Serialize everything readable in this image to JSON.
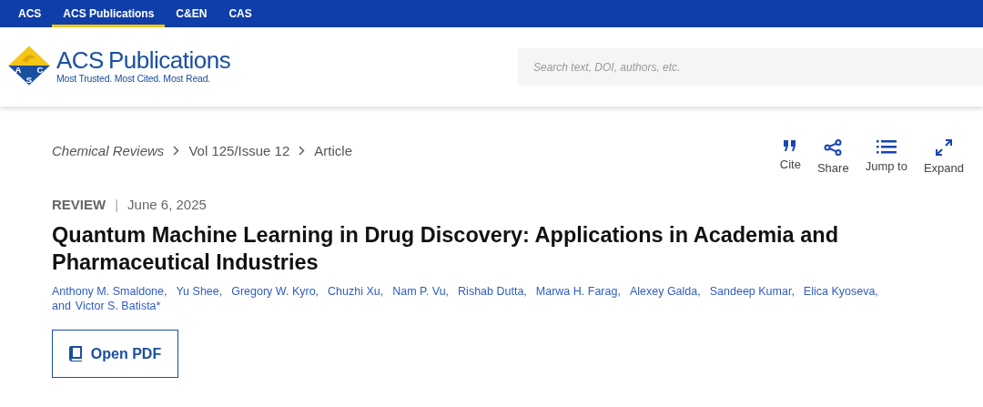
{
  "top_nav": [
    {
      "label": "ACS",
      "selected": false
    },
    {
      "label": "ACS Publications",
      "selected": true
    },
    {
      "label": "C&EN",
      "selected": false
    },
    {
      "label": "CAS",
      "selected": false
    }
  ],
  "logo": {
    "emblem_letters": [
      "A",
      "C",
      "S"
    ],
    "wordmark_bold": "ACS",
    "wordmark": "Publications",
    "tagline": "Most Trusted. Most Cited. Most Read."
  },
  "search": {
    "placeholder": "Search text, DOI, authors, etc."
  },
  "breadcrumb": [
    {
      "label": "Chemical Reviews",
      "kind": "journal"
    },
    {
      "label": "Vol 125/Issue 12",
      "kind": "issue"
    },
    {
      "label": "Article",
      "kind": "current"
    }
  ],
  "actions": [
    {
      "label": "Cite",
      "kind": "cite"
    },
    {
      "label": "Share",
      "kind": "share"
    },
    {
      "label": "Jump to",
      "kind": "jump"
    },
    {
      "label": "Expand",
      "kind": "expand"
    }
  ],
  "article": {
    "type": "REVIEW",
    "separator": "|",
    "date": "June 6, 2025",
    "title": "Quantum Machine Learning in Drug Discovery: Applications in Academia and Pharmaceutical Industries",
    "authors": [
      {
        "name": "Anthony M. Smaldone,"
      },
      {
        "name": "Yu Shee,"
      },
      {
        "name": "Gregory W. Kyro,"
      },
      {
        "name": "Chuzhi Xu,"
      },
      {
        "name": "Nam P. Vu,"
      },
      {
        "name": "Rishab Dutta,"
      },
      {
        "name": "Marwa H. Farag,"
      },
      {
        "name": "Alexey Galda,"
      },
      {
        "name": "Sandeep Kumar,"
      },
      {
        "name": "Elica Kyoseva,"
      }
    ],
    "conjunction": "and",
    "last_author": "Victor S. Batista*",
    "pdf_button": "Open PDF"
  }
}
